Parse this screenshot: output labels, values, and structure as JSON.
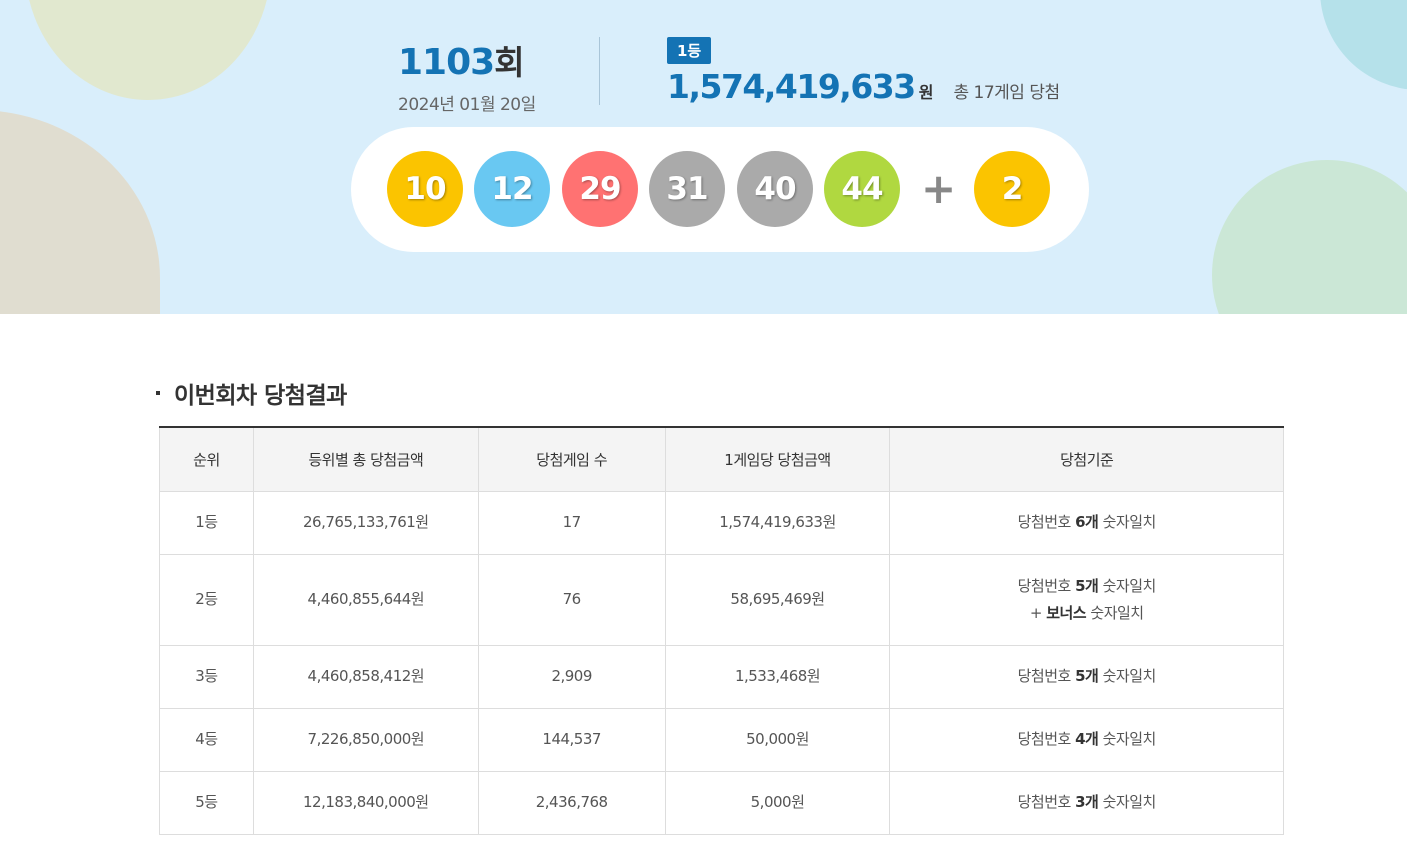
{
  "hero": {
    "round_number": "1103",
    "round_suffix": "회",
    "draw_date": "2024년 01월 20일",
    "first_prize_badge": "1등",
    "first_prize_amount": "1,574,419,633",
    "first_prize_unit": "원",
    "first_prize_games": "총 17게임 당첨"
  },
  "winning_numbers": [
    {
      "number": "10",
      "color": "#fbc400"
    },
    {
      "number": "12",
      "color": "#69c8f2"
    },
    {
      "number": "29",
      "color": "#ff7272"
    },
    {
      "number": "31",
      "color": "#aaaaaa"
    },
    {
      "number": "40",
      "color": "#aaaaaa"
    },
    {
      "number": "44",
      "color": "#b0d840"
    }
  ],
  "plus_sign": "+",
  "bonus_number": {
    "number": "2",
    "color": "#fbc400"
  },
  "section_title": "이번회차 당첨결과",
  "table": {
    "headers": [
      "순위",
      "등위별 총 당첨금액",
      "당첨게임 수",
      "1게임당 당첨금액",
      "당첨기준"
    ],
    "rows": [
      {
        "rank": "1등",
        "total": "26,765,133,761원",
        "games": "17",
        "per_game": "1,574,419,633원",
        "crit_prefix": "당첨번호",
        "crit_bold": "6개",
        "crit_suffix": "숫자일치",
        "crit2_prefix": "",
        "crit2_bold": "",
        "crit2_suffix": ""
      },
      {
        "rank": "2등",
        "total": "4,460,855,644원",
        "games": "76",
        "per_game": "58,695,469원",
        "crit_prefix": "당첨번호",
        "crit_bold": "5개",
        "crit_suffix": "숫자일치",
        "crit2_prefix": "+",
        "crit2_bold": "보너스",
        "crit2_suffix": "숫자일치"
      },
      {
        "rank": "3등",
        "total": "4,460,858,412원",
        "games": "2,909",
        "per_game": "1,533,468원",
        "crit_prefix": "당첨번호",
        "crit_bold": "5개",
        "crit_suffix": "숫자일치",
        "crit2_prefix": "",
        "crit2_bold": "",
        "crit2_suffix": ""
      },
      {
        "rank": "4등",
        "total": "7,226,850,000원",
        "games": "144,537",
        "per_game": "50,000원",
        "crit_prefix": "당첨번호",
        "crit_bold": "4개",
        "crit_suffix": "숫자일치",
        "crit2_prefix": "",
        "crit2_bold": "",
        "crit2_suffix": ""
      },
      {
        "rank": "5등",
        "total": "12,183,840,000원",
        "games": "2,436,768",
        "per_game": "5,000원",
        "crit_prefix": "당첨번호",
        "crit_bold": "3개",
        "crit_suffix": "숫자일치",
        "crit2_prefix": "",
        "crit2_bold": "",
        "crit2_suffix": ""
      }
    ]
  }
}
